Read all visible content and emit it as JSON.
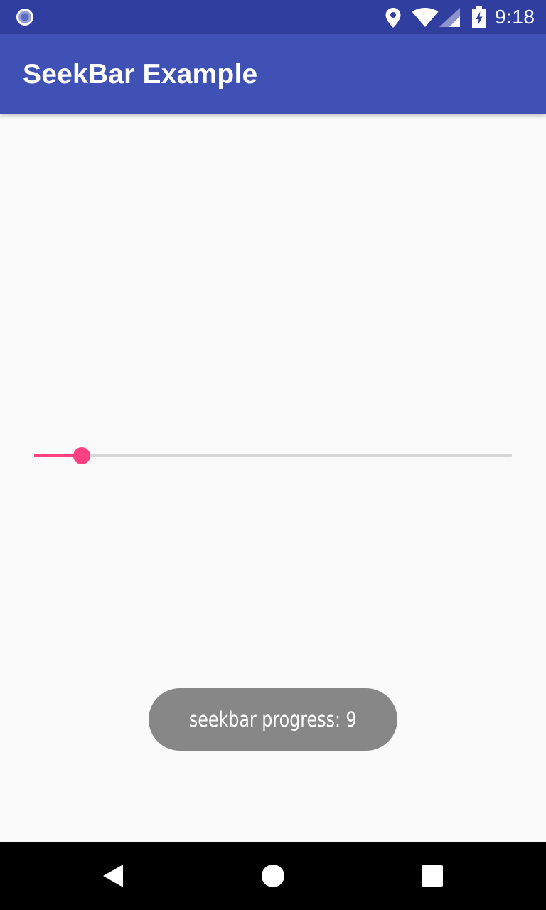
{
  "status_bar": {
    "time": "9:18",
    "icons": [
      "notification-radio-icon",
      "location-icon",
      "wifi-icon",
      "cell-signal-icon",
      "battery-charging-icon"
    ]
  },
  "app_bar": {
    "title": "SeekBar Example"
  },
  "seekbar": {
    "progress_fraction": 0.1,
    "max": 100,
    "accent_color": "#ff4081",
    "track_color": "#d6d6d6"
  },
  "toast": {
    "message": "seekbar progress: 9"
  },
  "nav_bar": {
    "buttons": [
      "back-icon",
      "home-icon",
      "recents-icon"
    ]
  },
  "colors": {
    "status_bar": "#303f9f",
    "app_bar": "#3f51b5",
    "background": "#fafafa",
    "toast_bg": "#878787"
  }
}
